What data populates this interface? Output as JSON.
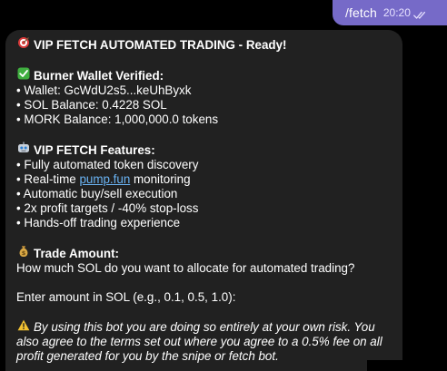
{
  "outgoing": {
    "text": "/fetch",
    "time": "20:20",
    "status_icon": "double-check-icon"
  },
  "message": {
    "title_icon": "target-icon",
    "title": "VIP FETCH AUTOMATED TRADING - Ready!",
    "wallet_section": {
      "icon": "check-mark-icon",
      "heading": "Burner Wallet Verified:",
      "lines": [
        "• Wallet: GcWdU2s5...keUhByxk",
        "• SOL Balance: 0.4228 SOL",
        "• MORK Balance: 1,000,000.0 tokens"
      ]
    },
    "features_section": {
      "icon": "robot-icon",
      "heading": "VIP FETCH Features:",
      "line1": "• Fully automated token discovery",
      "line2_prefix": "• Real-time ",
      "line2_link": "pump.fun",
      "line2_suffix": " monitoring",
      "line3": "• Automatic buy/sell execution",
      "line4": "• 2x profit targets / -40% stop-loss",
      "line5": "• Hands-off trading experience"
    },
    "trade_section": {
      "icon": "money-bag-icon",
      "heading": "Trade Amount:",
      "question": "How much SOL do you want to allocate for automated trading?",
      "prompt": "Enter amount in SOL (e.g., 0.1, 0.5, 1.0):"
    },
    "disclaimer": {
      "icon": "warning-icon",
      "line1": "By using this bot you are doing so entirely at your own risk. You",
      "line2": "also agree to the terms set out where you agree to a 0.5% fee on all",
      "line3": "profit generated for you by the snipe or fetch bot."
    }
  },
  "colors": {
    "outgoing_bubble": "#766ac8",
    "incoming_bubble": "#212121",
    "link": "#6ab3f3",
    "background": "#000000"
  }
}
